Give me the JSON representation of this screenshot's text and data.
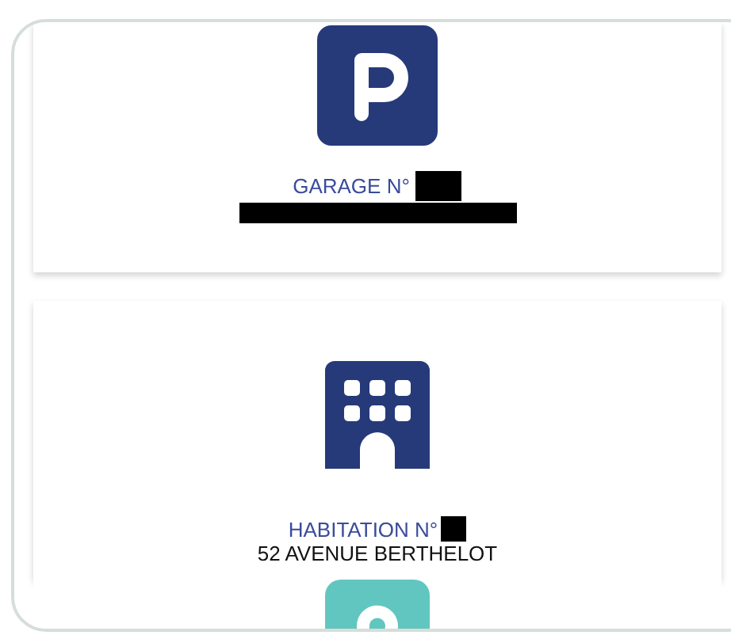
{
  "cards": [
    {
      "kind": "parking",
      "title": "GARAGE N°",
      "number_redacted": true,
      "address_redacted": true
    },
    {
      "kind": "building",
      "title": "HABITATION N°",
      "number_redacted": true,
      "address": "52 AVENUE BERTHELOT"
    },
    {
      "kind": "unknown"
    }
  ]
}
